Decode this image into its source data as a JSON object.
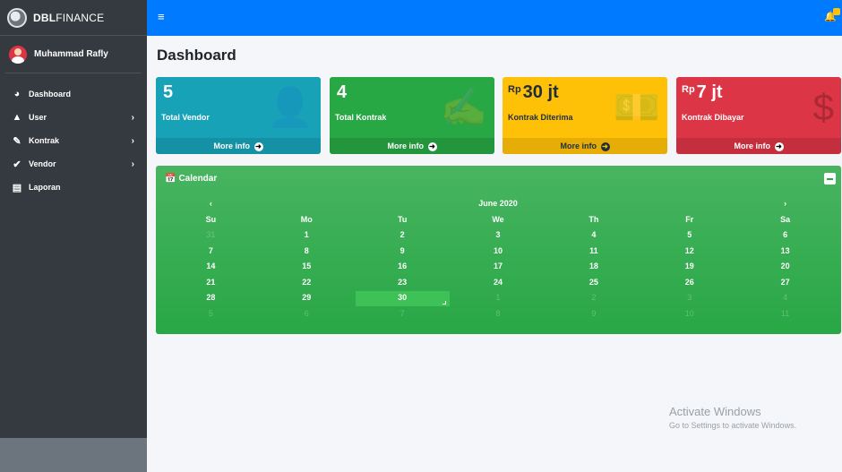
{
  "brand": {
    "bold": "DBL",
    "rest": "FINANCE"
  },
  "user": {
    "name": "Muhammad Rafly"
  },
  "nav": [
    {
      "label": "Dashboard",
      "icon": "tachometer-icon",
      "glyph": "◕",
      "chevron": ""
    },
    {
      "label": "User",
      "icon": "user-icon",
      "glyph": "▲",
      "chevron": "›"
    },
    {
      "label": "Kontrak",
      "icon": "file-signature-icon",
      "glyph": "✎",
      "chevron": "›"
    },
    {
      "label": "Vendor",
      "icon": "user-check-icon",
      "glyph": "✔",
      "chevron": "›"
    },
    {
      "label": "Laporan",
      "icon": "file-icon",
      "glyph": "▤",
      "chevron": ""
    }
  ],
  "topbar": {
    "menu_glyph": "≡",
    "bell_glyph": "🔔"
  },
  "page": {
    "title": "Dashboard"
  },
  "boxes": [
    {
      "value": "5",
      "prefix": "",
      "label": "Total Vendor",
      "footer": "More info",
      "icon": "user-check-icon",
      "color": "#17a2b8"
    },
    {
      "value": "4",
      "prefix": "",
      "label": "Total Kontrak",
      "footer": "More info",
      "icon": "file-signature-icon",
      "color": "#28a745"
    },
    {
      "value": "30 jt",
      "prefix": "Rp",
      "label": "Kontrak Diterima",
      "footer": "More info",
      "icon": "money-bill-icon",
      "color": "#ffc107"
    },
    {
      "value": "7 jt",
      "prefix": "Rp",
      "label": "Kontrak Dibayar",
      "footer": "More info",
      "icon": "dollar-sign-icon",
      "color": "#dc3545"
    }
  ],
  "calendar": {
    "title": "Calendar",
    "month": "June 2020",
    "prev": "‹",
    "next": "›",
    "weekdays": [
      "Su",
      "Mo",
      "Tu",
      "We",
      "Th",
      "Fr",
      "Sa"
    ],
    "weeks": [
      [
        "31",
        "1",
        "2",
        "3",
        "4",
        "5",
        "6"
      ],
      [
        "7",
        "8",
        "9",
        "10",
        "11",
        "12",
        "13"
      ],
      [
        "14",
        "15",
        "16",
        "17",
        "18",
        "19",
        "20"
      ],
      [
        "21",
        "22",
        "23",
        "24",
        "25",
        "26",
        "27"
      ],
      [
        "28",
        "29",
        "30",
        "1",
        "2",
        "3",
        "4"
      ],
      [
        "5",
        "6",
        "7",
        "8",
        "9",
        "10",
        "11"
      ]
    ],
    "selected": "30"
  },
  "watermark": {
    "line1": "Activate Windows",
    "line2": "Go to Settings to activate Windows."
  },
  "colors": {
    "topbar": "#007bff",
    "sidebar": "#343a40",
    "calendar": "#28a745"
  }
}
